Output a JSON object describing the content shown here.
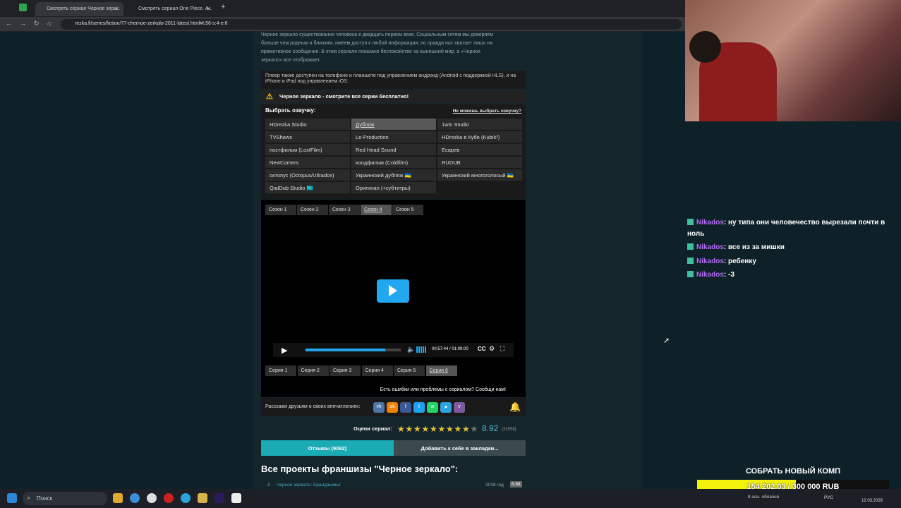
{
  "browser": {
    "tabs": [
      {
        "title": "Смотреть сериал Черное зерк..."
      },
      {
        "title": "Смотреть сериал One Piece. А..."
      }
    ],
    "new_tab": "+",
    "url": "rezka.fi/series/fiction/77-chernoe-zerkalo-2011-latest.html#t:56-s:4-e:6"
  },
  "page": {
    "desc_lines": [
      "Черное зеркало существовании человека в двадцать первом веке. Социальным сетям мы доверяем",
      "больше чем родным и близким, имеем доступ к любой информации, но правда нас хватает лишь на",
      "примитивное сообщение. В этом сериале показано беспокойство за нынешний мир, а «Черное",
      "зеркало» все отображает."
    ],
    "player_note": "Плеер также доступен на телефоне и планшете под управлением андроид (Android с поддержкой HLS), и на iPhone и iPad под управлением iOS.",
    "warning": "Черное зеркало - смотрите все серии бесплатно!",
    "voice_title": "Выбрать озвучку:",
    "voice_help": "Не можешь выбрать озвучку?",
    "voices": [
      [
        "HDrezka Studio",
        "Дубляж",
        "1win Studio"
      ],
      [
        "TVShows",
        "Le-Production",
        "HDrezka в Кубе (Kubik³)"
      ],
      [
        "постфильм (LostFilm)",
        "Red Head Sound",
        "Ecapeв"
      ],
      [
        "NewComers",
        "колдфильм (Coldfilm)",
        "RUDUB"
      ],
      [
        "октопус (Octopus/Ultradox)",
        "Украинский дубляж 🇺🇦",
        "Украинский многоголосый 🇺🇦"
      ],
      [
        "QialDub Studio 🇰🇿",
        "Оригинал (+субтитры)",
        ""
      ]
    ],
    "seasons": [
      "Сезон 1",
      "Сезон 2",
      "Сезон 3",
      "Сезон 4",
      "Сезон 5"
    ],
    "time": "00:57:44 / 01:09:00",
    "progress": 0.84,
    "episodes": [
      "Серия 1",
      "Серия 2",
      "Серия 3",
      "Серия 4",
      "Серия 5",
      "Серия 6"
    ],
    "report": "Есть ошибки или проблемы с сериалом? Сообщи нам!",
    "share_label": "Расскажи друзьям о своих впечатлениях:",
    "rating_label": "Оцени сериал:",
    "rating": "8.92",
    "rating_count": "(31558)",
    "reviews_button": "Отзывы (9092)",
    "bookmark_button": "Добавить к себе в закладки...",
    "franchise_title": "Все проекты франшизы \"Черное зеркало\":",
    "franchise_item": {
      "num": "2",
      "title": "Черное зеркало: Брандашмыг",
      "year": "2018 год",
      "score": "6.88"
    }
  },
  "chat": [
    {
      "user": "Nikados",
      "text": ": ну типа они человечество вырезали почти в ноль"
    },
    {
      "user": "Nikados",
      "text": ": все из за мишки"
    },
    {
      "user": "Nikados",
      "text": ": ребенку"
    },
    {
      "user": "Nikados",
      "text": ": -3"
    }
  ],
  "donation": {
    "title": "СОБРАТЬ НОВЫЙ КОМП",
    "amount": "154 202.03 / 300 000 RUB",
    "fraction": 0.514
  },
  "taskbar": {
    "search": "Поиск",
    "weather": "8 осн. облачно",
    "lang": "РУС",
    "date": "12.03.2026"
  },
  "colors": {
    "accent": "#1aabb4",
    "play": "#22a7f0",
    "chat_name": "#b36cf5",
    "donation": "#f2f20a"
  }
}
